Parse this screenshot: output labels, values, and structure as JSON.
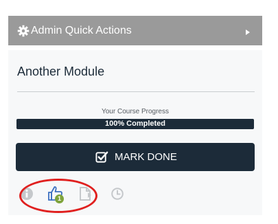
{
  "admin_bar": {
    "title": "Admin Quick Actions",
    "icon": "gear-icon",
    "expand_icon": "chevron-right-icon"
  },
  "module": {
    "title": "Another Module"
  },
  "progress": {
    "label": "Your Course Progress",
    "status_text": "100% Completed",
    "percent": 100
  },
  "mark_done": {
    "label": "MARK DONE",
    "icon": "checkbox-icon"
  },
  "actions": {
    "info_icon": "info-icon",
    "like_icon": "thumbs-up-icon",
    "like_count": "1",
    "doc_icon": "document-icon",
    "history_icon": "clock-icon"
  },
  "colors": {
    "admin_bar": "#9a9a9a",
    "primary": "#1c2b39",
    "badge": "#7ea33b",
    "like_icon": "#3b6fc0",
    "highlight": "#e0201f"
  }
}
